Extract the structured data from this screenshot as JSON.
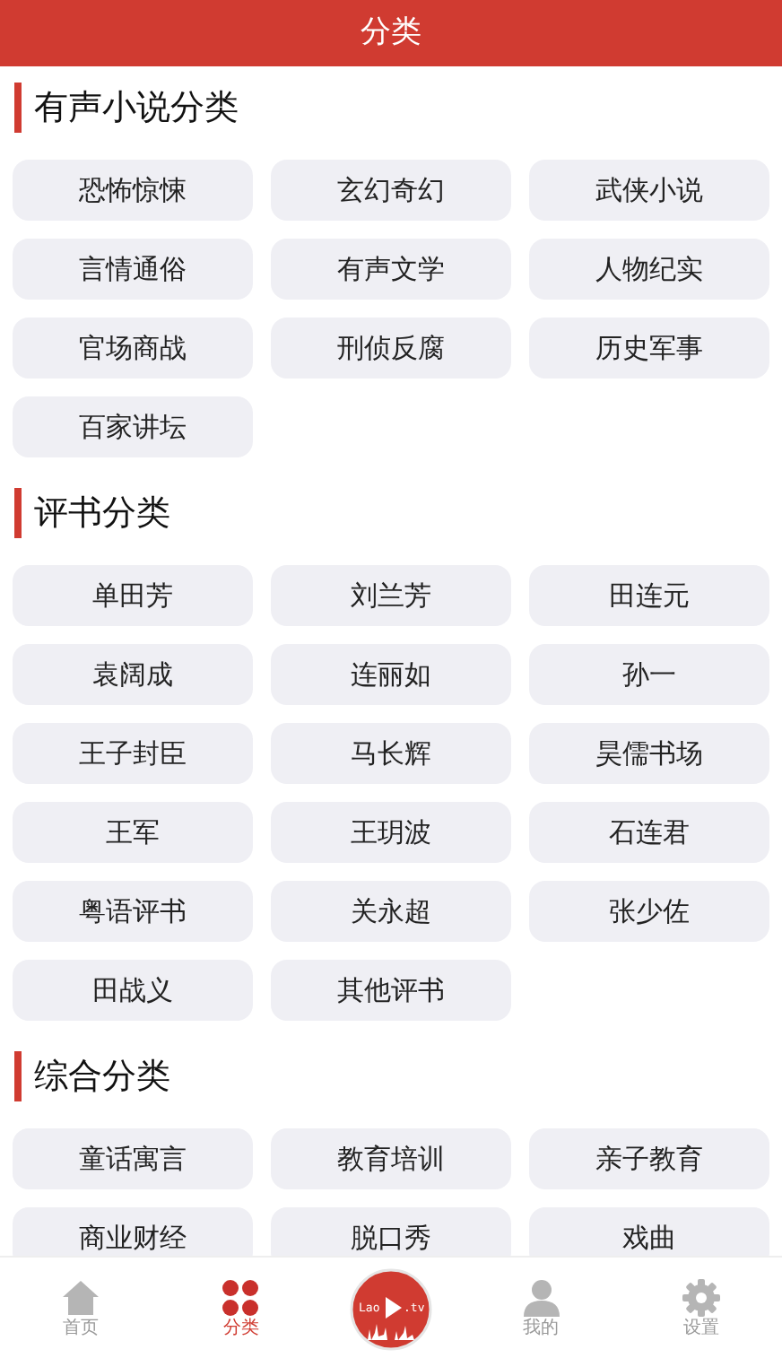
{
  "header": {
    "title": "分类"
  },
  "sections": [
    {
      "title": "有声小说分类",
      "items": [
        "恐怖惊悚",
        "玄幻奇幻",
        "武侠小说",
        "言情通俗",
        "有声文学",
        "人物纪实",
        "官场商战",
        "刑侦反腐",
        "历史军事",
        "百家讲坛"
      ]
    },
    {
      "title": "评书分类",
      "items": [
        "单田芳",
        "刘兰芳",
        "田连元",
        "袁阔成",
        "连丽如",
        "孙一",
        "王子封臣",
        "马长辉",
        "昊儒书场",
        "王军",
        "王玥波",
        "石连君",
        "粤语评书",
        "关永超",
        "张少佐",
        "田战义",
        "其他评书"
      ]
    },
    {
      "title": "综合分类",
      "items": [
        "童话寓言",
        "教育培训",
        "亲子教育",
        "商业财经",
        "脱口秀",
        "戏曲"
      ]
    }
  ],
  "tabbar": [
    {
      "kind": "home",
      "label": "首页",
      "selected": false
    },
    {
      "kind": "grid",
      "label": "分类",
      "selected": true
    },
    {
      "kind": "logo",
      "logo_text": [
        "Lao",
        ".tv"
      ]
    },
    {
      "kind": "person",
      "label": "我的",
      "selected": false
    },
    {
      "kind": "gear",
      "label": "设置",
      "selected": false
    }
  ]
}
